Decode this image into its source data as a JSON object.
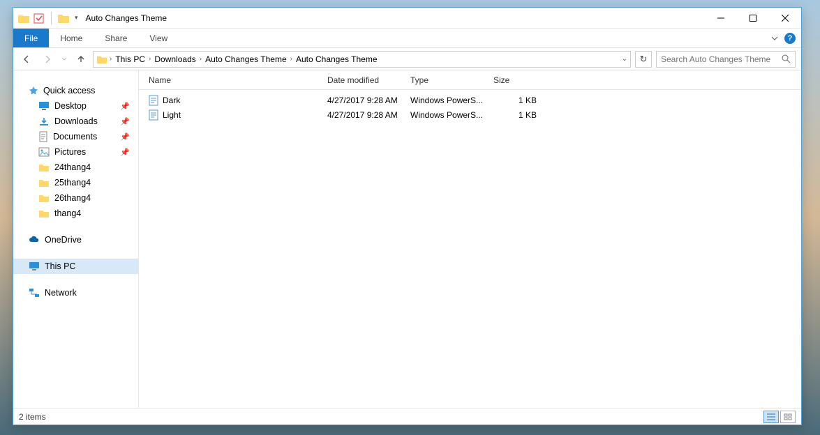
{
  "window": {
    "title": "Auto Changes Theme"
  },
  "ribbon": {
    "file": "File",
    "home": "Home",
    "share": "Share",
    "view": "View"
  },
  "breadcrumb": {
    "items": [
      "This PC",
      "Downloads",
      "Auto Changes Theme",
      "Auto Changes Theme"
    ]
  },
  "search": {
    "placeholder": "Search Auto Changes Theme"
  },
  "navpane": {
    "quick_access": "Quick access",
    "quick_items": [
      {
        "label": "Desktop",
        "pinned": true,
        "icon": "desktop"
      },
      {
        "label": "Downloads",
        "pinned": true,
        "icon": "downloads"
      },
      {
        "label": "Documents",
        "pinned": true,
        "icon": "documents"
      },
      {
        "label": "Pictures",
        "pinned": true,
        "icon": "pictures"
      },
      {
        "label": "24thang4",
        "pinned": false,
        "icon": "folder"
      },
      {
        "label": "25thang4",
        "pinned": false,
        "icon": "folder"
      },
      {
        "label": "26thang4",
        "pinned": false,
        "icon": "folder"
      },
      {
        "label": "thang4",
        "pinned": false,
        "icon": "folder"
      }
    ],
    "onedrive": "OneDrive",
    "this_pc": "This PC",
    "network": "Network"
  },
  "columns": {
    "name": "Name",
    "date": "Date modified",
    "type": "Type",
    "size": "Size"
  },
  "files": [
    {
      "name": "Dark",
      "date": "4/27/2017 9:28 AM",
      "type": "Windows PowerS...",
      "size": "1 KB"
    },
    {
      "name": "Light",
      "date": "4/27/2017 9:28 AM",
      "type": "Windows PowerS...",
      "size": "1 KB"
    }
  ],
  "status": {
    "count": "2 items"
  }
}
